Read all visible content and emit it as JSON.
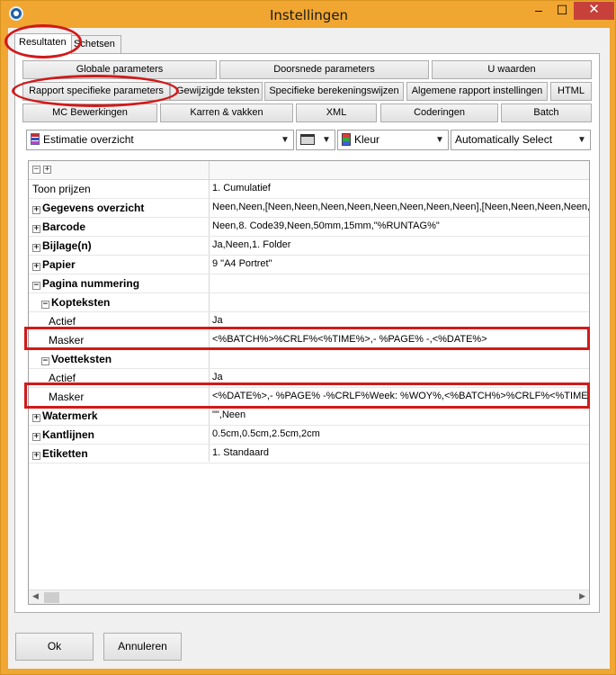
{
  "window": {
    "title": "Instellingen",
    "minimize": "–",
    "maximize": "☐",
    "close": "✕"
  },
  "tabs": [
    {
      "label": "Resultaten",
      "active": true
    },
    {
      "label": "Schetsen",
      "active": false
    }
  ],
  "buttons_row1": [
    "Globale parameters",
    "Doorsnede parameters",
    "U waarden"
  ],
  "buttons_row2": [
    "Rapport specifieke parameters",
    "Gewijzigde teksten",
    "Specifieke berekeningswijzen",
    "Algemene rapport instellingen",
    "HTML"
  ],
  "buttons_row3": [
    "MC Bewerkingen",
    "Karren & vakken",
    "XML",
    "Coderingen",
    "Batch"
  ],
  "combos": {
    "report": "Estimatie overzicht",
    "color": "Kleur",
    "select": "Automatically Select"
  },
  "grid": {
    "header_expand": "−",
    "header_collapse": "+",
    "rows": [
      {
        "name": "Toon prijzen",
        "value": "1. Cumulatief",
        "bold": false,
        "indent": 0,
        "toggle": ""
      },
      {
        "name": "Gegevens overzicht",
        "value": "Neen,Neen,[Neen,Neen,Neen,Neen,Neen,Neen,Neen,Neen],[Neen,Neen,Neen,Neen,Neen,Neen,Neen,Neen]",
        "bold": true,
        "indent": 0,
        "toggle": "+"
      },
      {
        "name": "Barcode",
        "value": "Neen,8. Code39,Neen,50mm,15mm,\"%RUNTAG%\"",
        "bold": true,
        "indent": 0,
        "toggle": "+"
      },
      {
        "name": "Bijlage(n)",
        "value": "Ja,Neen,1. Folder",
        "bold": true,
        "indent": 0,
        "toggle": "+"
      },
      {
        "name": "Papier",
        "value": "9 \"A4 Portret\"",
        "bold": true,
        "indent": 0,
        "toggle": "+"
      },
      {
        "name": "Pagina nummering",
        "value": "",
        "bold": true,
        "indent": 0,
        "toggle": "−"
      },
      {
        "name": "Kopteksten",
        "value": "",
        "bold": true,
        "indent": 1,
        "toggle": "−"
      },
      {
        "name": "Actief",
        "value": "Ja",
        "bold": false,
        "indent": 2,
        "toggle": ""
      },
      {
        "name": "Masker",
        "value": "<%BATCH%>%CRLF%<%TIME%>,- %PAGE% -,<%DATE%>",
        "bold": false,
        "indent": 2,
        "toggle": ""
      },
      {
        "name": "Voetteksten",
        "value": "",
        "bold": true,
        "indent": 1,
        "toggle": "−"
      },
      {
        "name": "Actief",
        "value": "Ja",
        "bold": false,
        "indent": 2,
        "toggle": ""
      },
      {
        "name": "Masker",
        "value": "<%DATE%>,- %PAGE% -%CRLF%Week: %WOY%,<%BATCH%>%CRLF%<%TIME%>",
        "bold": false,
        "indent": 2,
        "toggle": ""
      },
      {
        "name": "Watermerk",
        "value": "\"\",Neen",
        "bold": true,
        "indent": 0,
        "toggle": "+"
      },
      {
        "name": "Kantlijnen",
        "value": "0.5cm,0.5cm,2.5cm,2cm",
        "bold": true,
        "indent": 0,
        "toggle": "+"
      },
      {
        "name": "Etiketten",
        "value": "1. Standaard",
        "bold": true,
        "indent": 0,
        "toggle": "+"
      }
    ]
  },
  "footer": {
    "ok": "Ok",
    "cancel": "Annuleren"
  },
  "colors": {
    "title_bar": "#f0a630",
    "close_button": "#c7413a",
    "highlight": "#d11a1a"
  }
}
